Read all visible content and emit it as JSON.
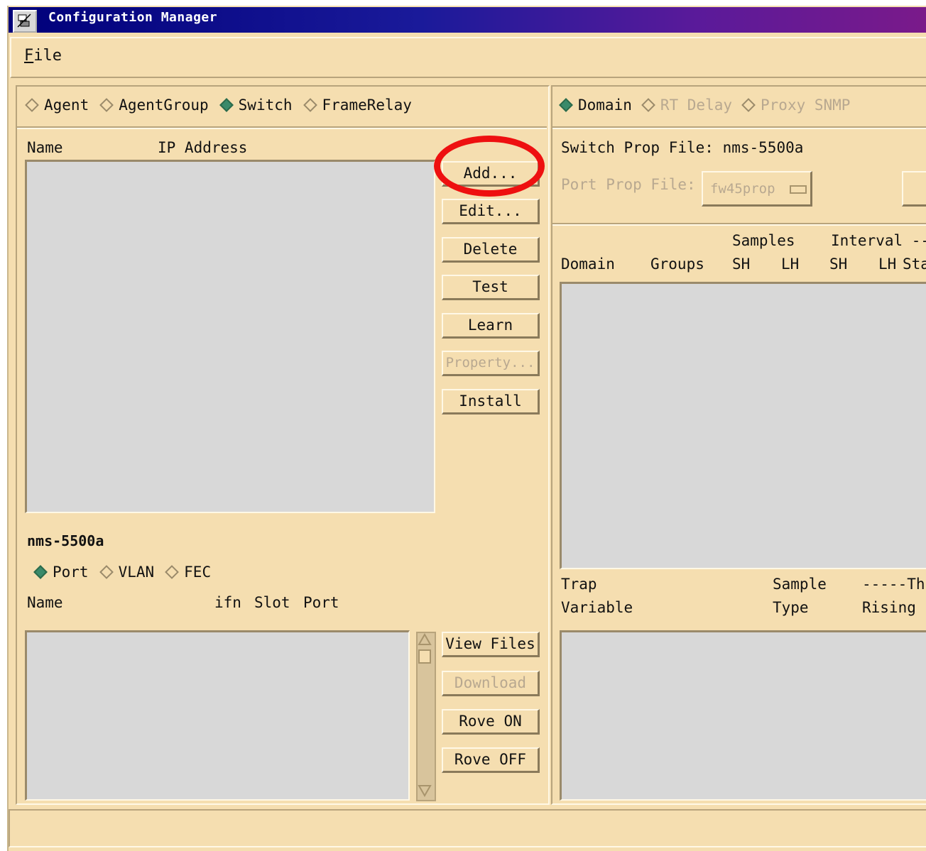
{
  "window": {
    "title": "Configuration Manager"
  },
  "menu": {
    "file": "File"
  },
  "left": {
    "type_options": [
      {
        "label": "Agent",
        "selected": false
      },
      {
        "label": "AgentGroup",
        "selected": false
      },
      {
        "label": "Switch",
        "selected": true
      },
      {
        "label": "FrameRelay",
        "selected": false
      }
    ],
    "list_headers": {
      "name": "Name",
      "ip": "IP Address"
    },
    "buttons": {
      "add": "Add...",
      "edit": "Edit...",
      "delete": "Delete",
      "test": "Test",
      "learn": "Learn",
      "property": "Property...",
      "install": "Install"
    },
    "selected_device": "nms-5500a",
    "port_options": [
      {
        "label": "Port",
        "selected": true
      },
      {
        "label": "VLAN",
        "selected": false
      },
      {
        "label": "FEC",
        "selected": false
      }
    ],
    "port_headers": {
      "name": "Name",
      "ifn": "ifn",
      "slot": "Slot",
      "port": "Port"
    },
    "port_buttons": {
      "view_files": "View Files",
      "download": "Download",
      "rove_on": "Rove ON",
      "rove_off": "Rove OFF"
    }
  },
  "right": {
    "mode_options": [
      {
        "label": "Domain",
        "selected": true,
        "enabled": true
      },
      {
        "label": "RT Delay",
        "selected": false,
        "enabled": false
      },
      {
        "label": "Proxy SNMP",
        "selected": false,
        "enabled": false
      }
    ],
    "switch_prop_label": "Switch Prop File:",
    "switch_prop_value": "nms-5500a",
    "port_prop_label": "Port Prop File:",
    "port_prop_value": "fw45prop",
    "domain_headers": {
      "samples": "Samples",
      "interval": "Interval ---",
      "domain": "Domain",
      "groups": "Groups",
      "sh1": "SH",
      "lh1": "LH",
      "sh2": "SH",
      "lh2": "LH",
      "sta": "Sta"
    },
    "trap_headers": {
      "trap": "Trap",
      "variable": "Variable",
      "sample": "Sample",
      "type": "Type",
      "thr": "-----Thr",
      "rising": "Rising"
    }
  },
  "colors": {
    "highlight": "#ee1010",
    "window_bg": "#f5deb0",
    "list_bg": "#d8d8d8",
    "title_bg": "#00007a"
  }
}
